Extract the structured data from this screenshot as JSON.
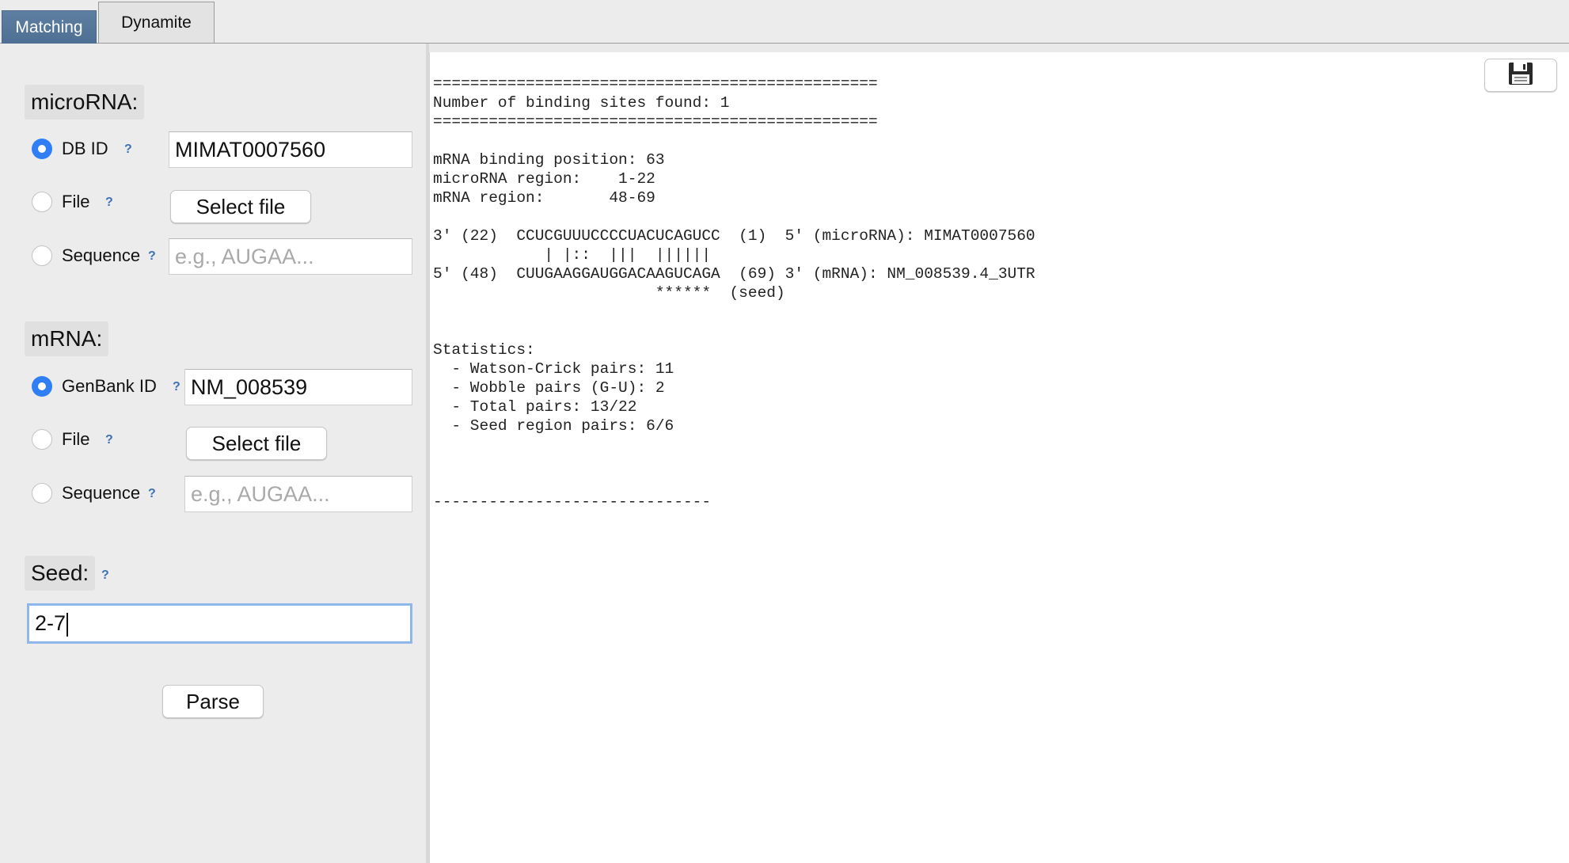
{
  "tabs": [
    {
      "label": "Matching",
      "active": true
    },
    {
      "label": "Dynamite",
      "active": false
    }
  ],
  "microrna": {
    "section_label": "microRNA:",
    "options": [
      {
        "label": "DB ID",
        "help": "?",
        "selected": true
      },
      {
        "label": "File",
        "help": "?",
        "selected": false
      },
      {
        "label": "Sequence",
        "help": "?",
        "selected": false
      }
    ],
    "db_id_value": "MIMAT0007560",
    "file_button_label": "Select file",
    "sequence_placeholder": "e.g., AUGAA..."
  },
  "mrna": {
    "section_label": "mRNA:",
    "options": [
      {
        "label": "GenBank ID",
        "help": "?",
        "selected": true
      },
      {
        "label": "File",
        "help": "?",
        "selected": false
      },
      {
        "label": "Sequence",
        "help": "?",
        "selected": false
      }
    ],
    "genbank_id_value": "NM_008539",
    "file_button_label": "Select file",
    "sequence_placeholder": "e.g., AUGAA..."
  },
  "seed": {
    "label": "Seed:",
    "help": "?",
    "value": "2-7"
  },
  "parse_button_label": "Parse",
  "output": {
    "save_icon": "floppy-disk-icon",
    "lines": [
      "================================================",
      "Number of binding sites found: 1",
      "================================================",
      "",
      "mRNA binding position: 63",
      "microRNA region:    1-22",
      "mRNA region:       48-69",
      "",
      "3' (22)  CCUCGUUUCCCCUACUCAGUCC  (1)  5' (microRNA): MIMAT0007560",
      "            | |::  |||  ||||||",
      "5' (48)  CUUGAAGGAUGGACAAGUCAGA  (69) 3' (mRNA): NM_008539.4_3UTR",
      "                        ******  (seed)",
      "",
      "",
      "Statistics:",
      "  - Watson-Crick pairs: 11",
      "  - Wobble pairs (G-U): 2",
      "  - Total pairs: 13/22",
      "  - Seed region pairs: 6/6",
      "",
      "",
      "",
      "------------------------------"
    ]
  }
}
